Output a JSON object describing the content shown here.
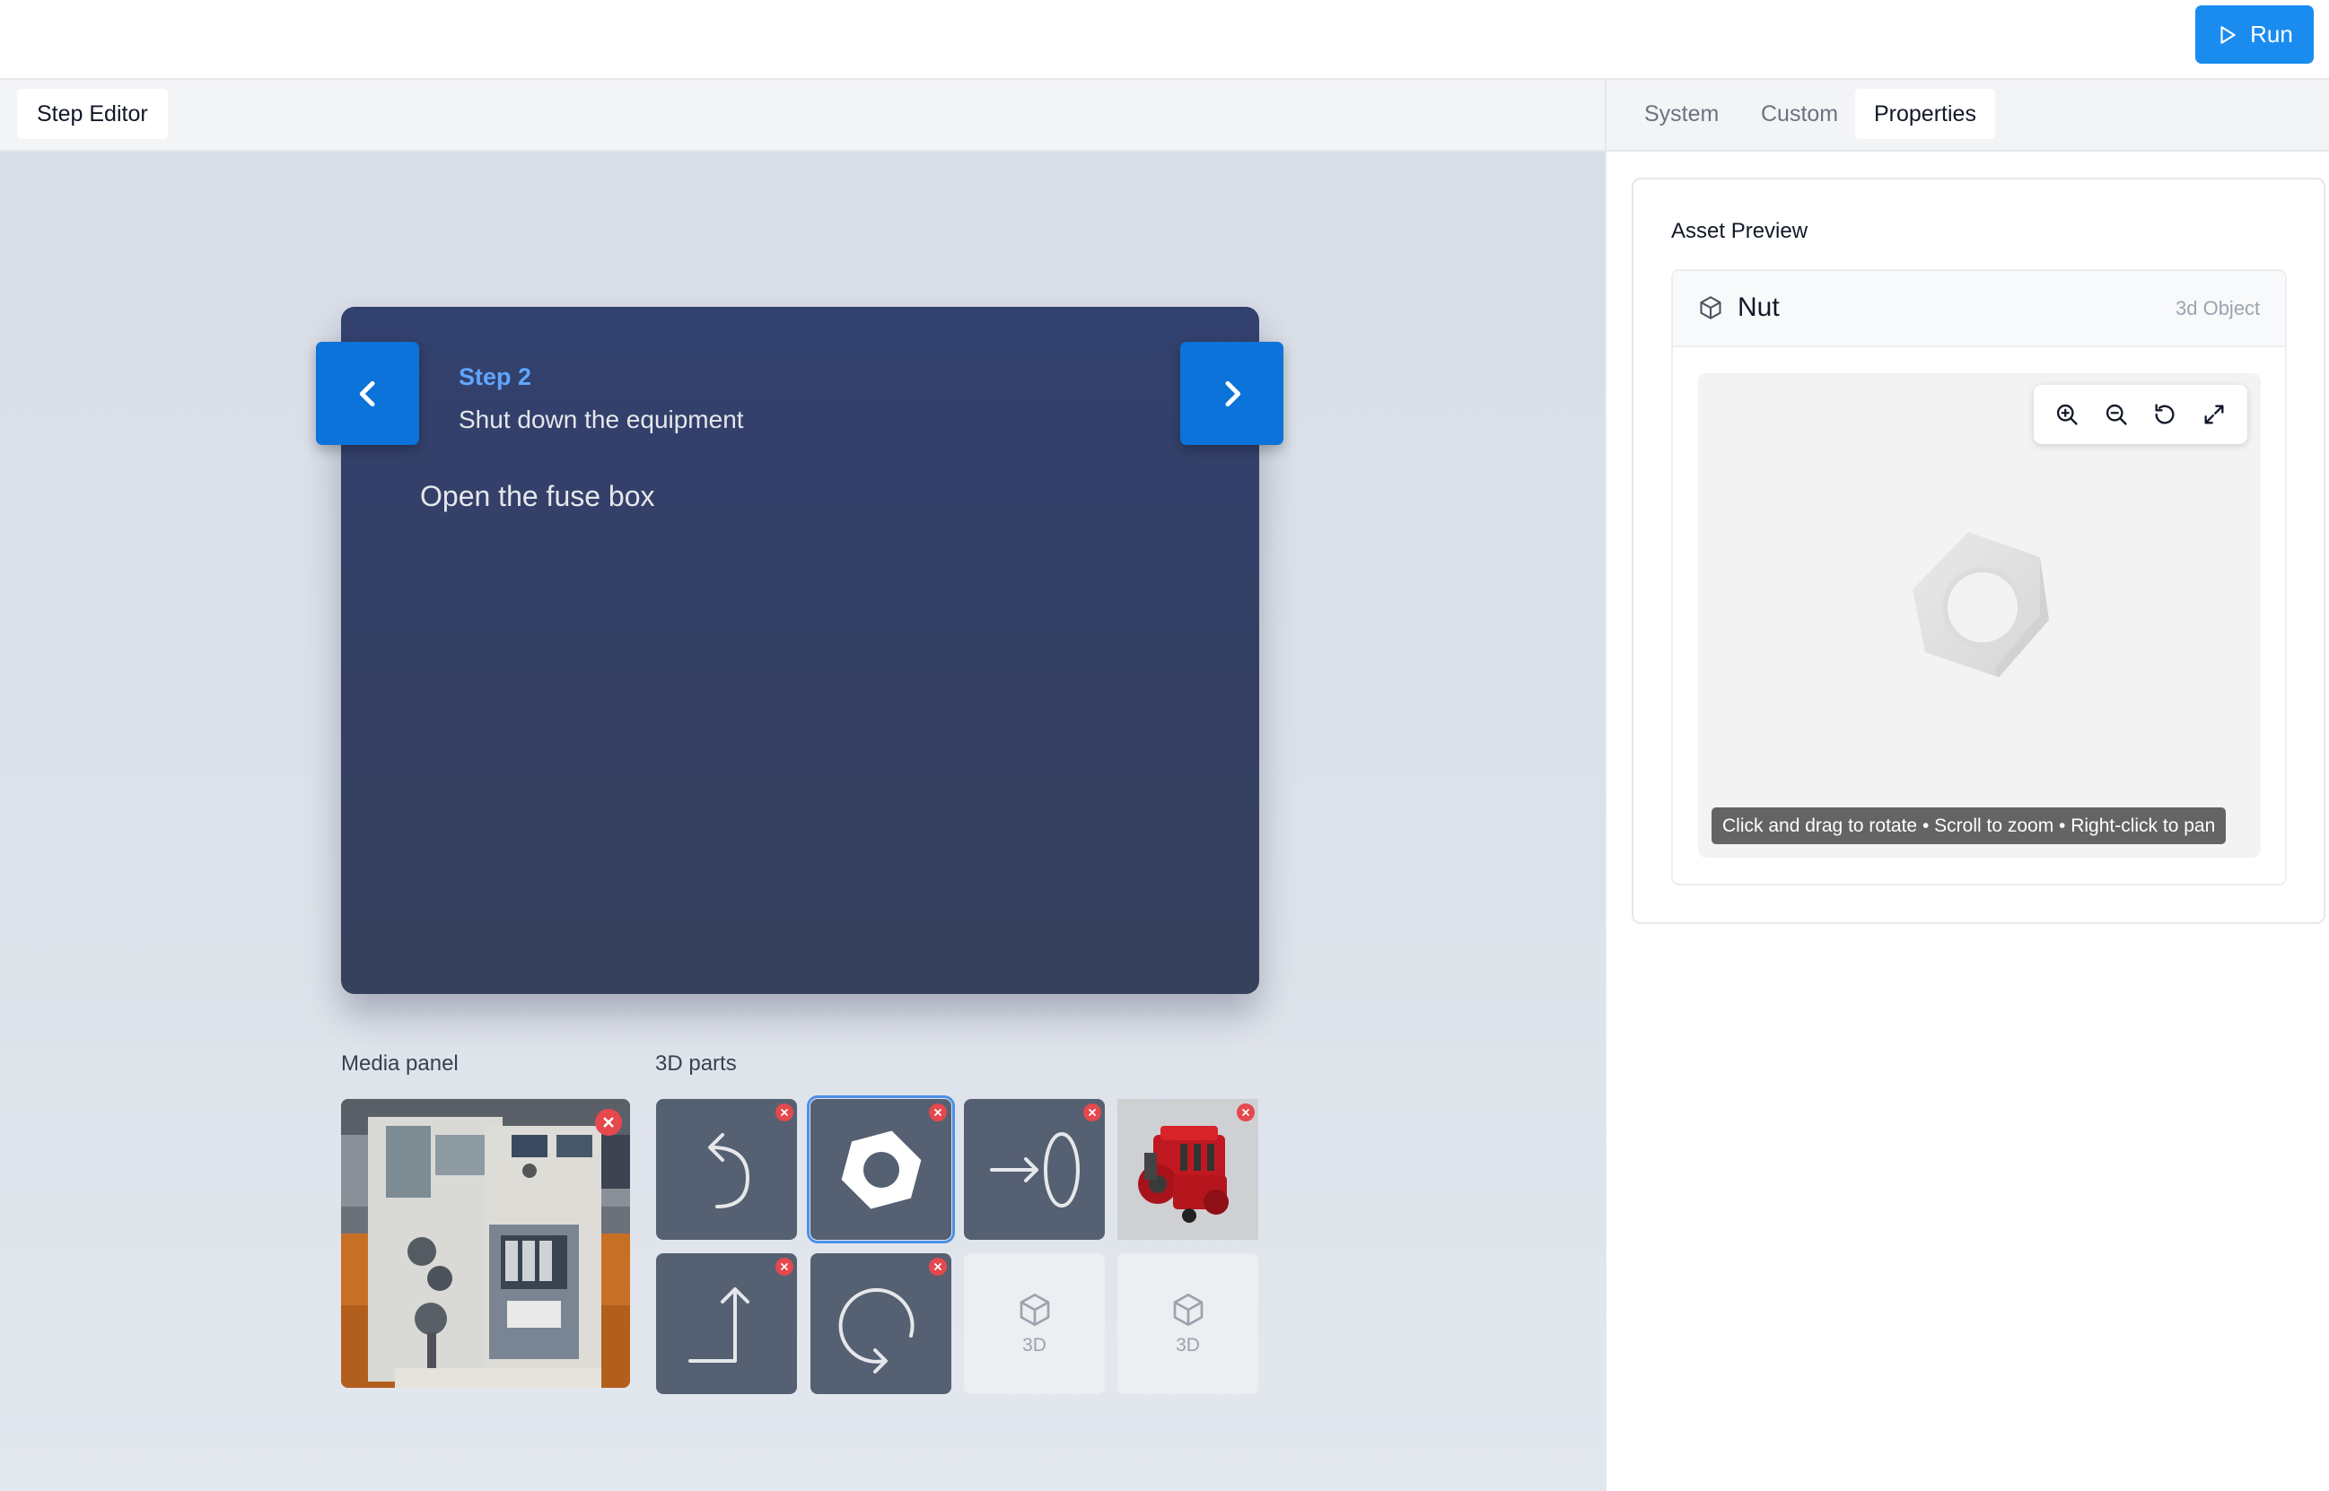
{
  "toolbar": {
    "run_label": "Run",
    "run_icon": "play-icon"
  },
  "editor": {
    "tab_label": "Step Editor"
  },
  "step": {
    "number": "Step 2",
    "title": "Shut down the equipment",
    "instruction": "Open the fuse box",
    "prev_icon": "chevron-left-icon",
    "next_icon": "chevron-right-icon"
  },
  "media": {
    "label": "Media panel",
    "item": {
      "name": "equipment-photo",
      "removable": true
    }
  },
  "parts": {
    "label": "3D parts",
    "items": [
      {
        "icon": "arrow-return-icon",
        "removable": true,
        "selected": false
      },
      {
        "icon": "hex-nut-icon",
        "removable": true,
        "selected": true
      },
      {
        "icon": "arrow-into-ring-icon",
        "removable": true,
        "selected": false
      },
      {
        "icon": "engine-thumbnail",
        "removable": true,
        "selected": false
      },
      {
        "icon": "arrow-up-turn-icon",
        "removable": true,
        "selected": false
      },
      {
        "icon": "rotate-loop-icon",
        "removable": true,
        "selected": false
      },
      {
        "icon": "cube-icon",
        "label": "3D",
        "removable": false,
        "selected": false
      },
      {
        "icon": "cube-icon",
        "label": "3D",
        "removable": false,
        "selected": false
      }
    ]
  },
  "panel": {
    "tabs": [
      {
        "label": "System",
        "active": false
      },
      {
        "label": "Custom",
        "active": false
      },
      {
        "label": "Properties",
        "active": true
      }
    ],
    "preview": {
      "title": "Asset Preview",
      "asset_name": "Nut",
      "asset_type": "3d Object",
      "tools": [
        "zoom-in-icon",
        "zoom-out-icon",
        "reset-rotation-icon",
        "fullscreen-icon"
      ],
      "hint": "Click and drag to rotate • Scroll to zoom • Right-click to pan"
    }
  },
  "colors": {
    "accent": "#1a8cf0",
    "nav_button": "#0b73d9",
    "card_bg": "#33416f",
    "step_number": "#5fa6ff",
    "remove_badge": "#e5484d",
    "part_tile": "#556072"
  }
}
